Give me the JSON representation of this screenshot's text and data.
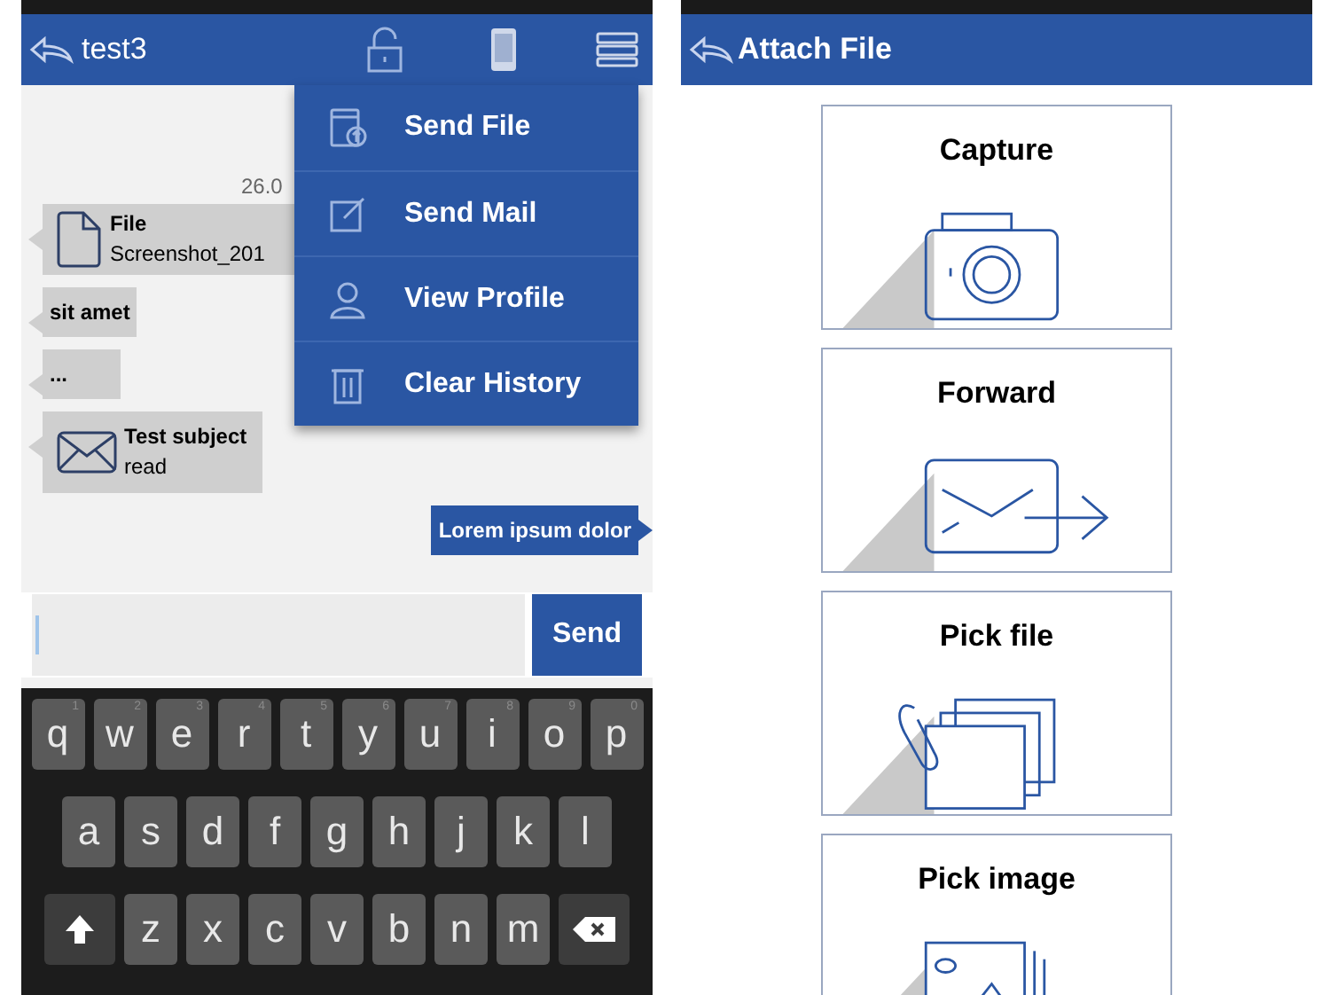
{
  "chat_screen": {
    "title": "test3",
    "menu": [
      {
        "label": "Send File",
        "kind": "file"
      },
      {
        "label": "Send Mail",
        "kind": "mail"
      },
      {
        "label": "View Profile",
        "kind": "profile"
      },
      {
        "label": "Clear History",
        "kind": "trash"
      }
    ],
    "date": "26.0",
    "messages": [
      {
        "kind": "file",
        "title": "File",
        "subtitle": "Screenshot_201",
        "outgoing": false
      },
      {
        "kind": "text",
        "text": "sit amet",
        "outgoing": false
      },
      {
        "kind": "text",
        "text": "...",
        "outgoing": false
      },
      {
        "kind": "mail",
        "title": "Test subject",
        "subtitle": "read",
        "outgoing": false
      },
      {
        "kind": "text",
        "text": "Lorem ipsum dolor",
        "outgoing": true
      }
    ],
    "send_button": "Send",
    "keyboard": [
      [
        {
          "kind": "char",
          "label": "q",
          "hint": "1"
        },
        {
          "kind": "char",
          "label": "w",
          "hint": "2"
        },
        {
          "kind": "char",
          "label": "e",
          "hint": "3"
        },
        {
          "kind": "char",
          "label": "r",
          "hint": "4"
        },
        {
          "kind": "char",
          "label": "t",
          "hint": "5"
        },
        {
          "kind": "char",
          "label": "y",
          "hint": "6"
        },
        {
          "kind": "char",
          "label": "u",
          "hint": "7"
        },
        {
          "kind": "char",
          "label": "i",
          "hint": "8"
        },
        {
          "kind": "char",
          "label": "o",
          "hint": "9"
        },
        {
          "kind": "char",
          "label": "p",
          "hint": "0"
        }
      ],
      [
        {
          "kind": "char",
          "label": "a"
        },
        {
          "kind": "char",
          "label": "s"
        },
        {
          "kind": "char",
          "label": "d"
        },
        {
          "kind": "char",
          "label": "f"
        },
        {
          "kind": "char",
          "label": "g"
        },
        {
          "kind": "char",
          "label": "h"
        },
        {
          "kind": "char",
          "label": "j"
        },
        {
          "kind": "char",
          "label": "k"
        },
        {
          "kind": "char",
          "label": "l"
        }
      ],
      [
        {
          "kind": "shift"
        },
        {
          "kind": "char",
          "label": "z"
        },
        {
          "kind": "char",
          "label": "x"
        },
        {
          "kind": "char",
          "label": "c"
        },
        {
          "kind": "char",
          "label": "v"
        },
        {
          "kind": "char",
          "label": "b"
        },
        {
          "kind": "char",
          "label": "n"
        },
        {
          "kind": "char",
          "label": "m"
        },
        {
          "kind": "backspace"
        }
      ]
    ]
  },
  "attach_screen": {
    "title": "Attach File",
    "options": [
      {
        "label": "Capture",
        "kind": "camera"
      },
      {
        "label": "Forward",
        "kind": "forward"
      },
      {
        "label": "Pick file",
        "kind": "files"
      },
      {
        "label": "Pick image",
        "kind": "image"
      }
    ]
  }
}
